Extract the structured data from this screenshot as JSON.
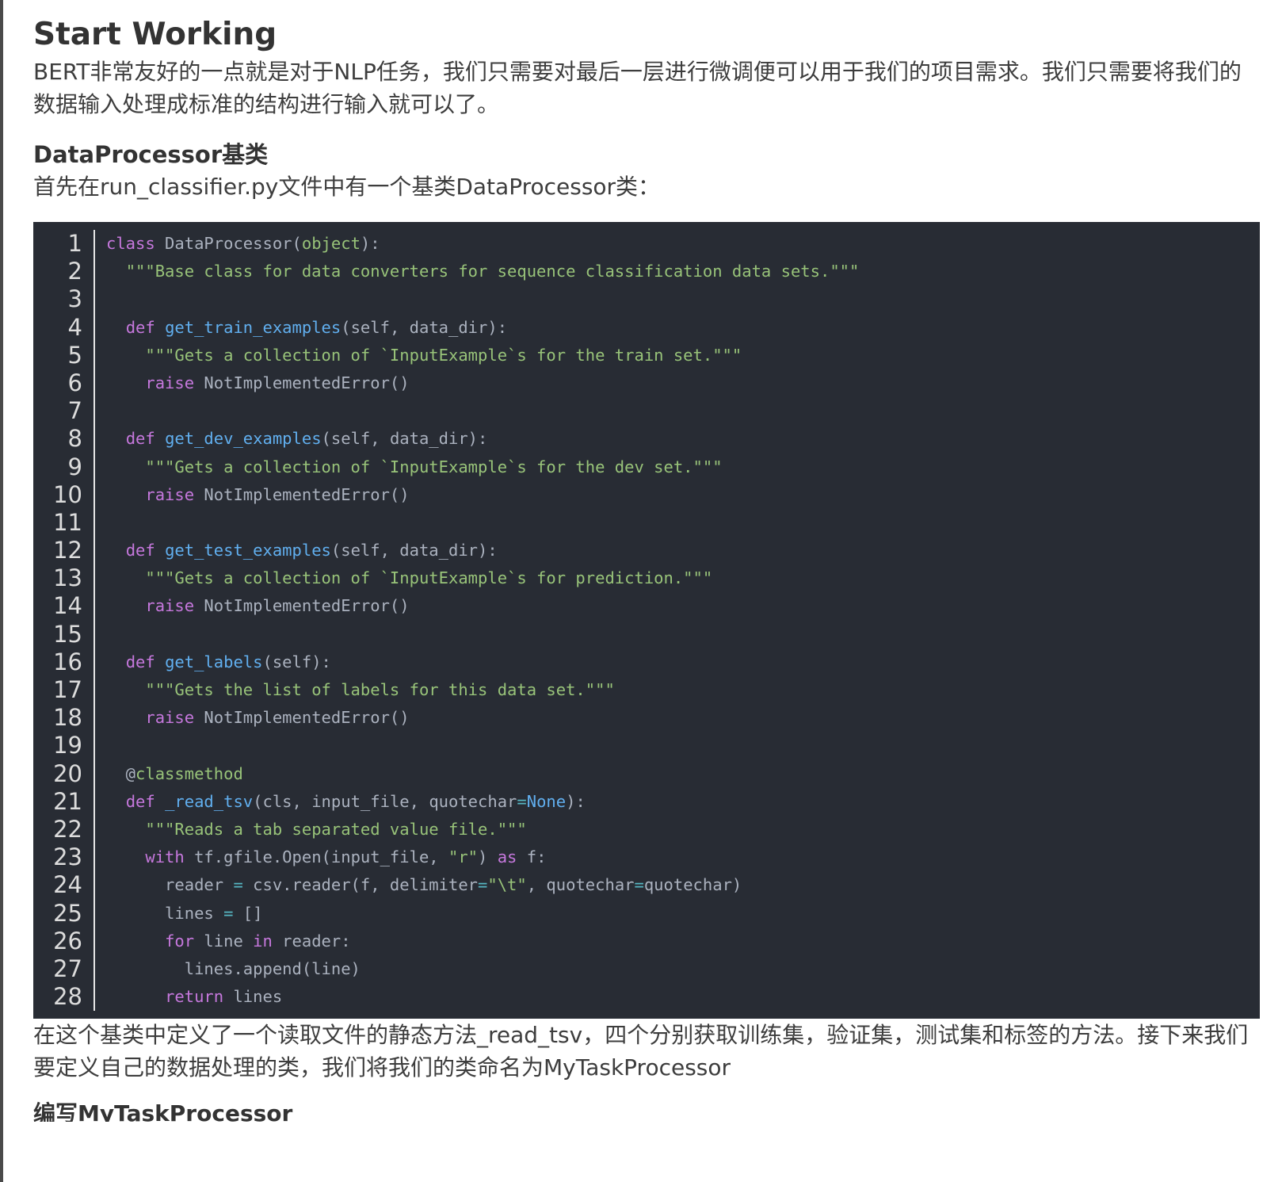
{
  "article": {
    "title": "Start Working",
    "intro": "BERT非常友好的一点就是对于NLP任务，我们只需要对最后一层进行微调便可以用于我们的项目需求。我们只需要将我们的数据输入处理成标准的结构进行输入就可以了。",
    "subtitle": "DataProcessor基类",
    "lead": "首先在run_classifier.py文件中有一个基类DataProcessor类：",
    "after_code": "在这个基类中定义了一个读取文件的静态方法_read_tsv，四个分别获取训练集，验证集，测试集和标签的方法。接下来我们要定义自己的数据处理的类，我们将我们的类命名为MyTaskProcessor",
    "cut_off_heading": "编写MyTaskProcessor"
  },
  "code": {
    "line_numbers": [
      "1",
      "2",
      "3",
      "4",
      "5",
      "6",
      "7",
      "8",
      "9",
      "10",
      "11",
      "12",
      "13",
      "14",
      "15",
      "16",
      "17",
      "18",
      "19",
      "20",
      "21",
      "22",
      "23",
      "24",
      "25",
      "26",
      "27",
      "28"
    ],
    "lines": [
      [
        [
          "kw",
          "class"
        ],
        [
          "pl",
          " DataProcessor("
        ],
        [
          "bi",
          "object"
        ],
        [
          "pl",
          "):"
        ]
      ],
      [
        [
          "pl",
          "  "
        ],
        [
          "st",
          "\"\"\"Base class for data converters for sequence classification data sets.\"\"\""
        ]
      ],
      [],
      [
        [
          "pl",
          "  "
        ],
        [
          "kw",
          "def"
        ],
        [
          "pl",
          " "
        ],
        [
          "fn",
          "get_train_examples"
        ],
        [
          "pl",
          "(self, data_dir):"
        ]
      ],
      [
        [
          "pl",
          "    "
        ],
        [
          "st",
          "\"\"\"Gets a collection of `InputExample`s for the train set.\"\"\""
        ]
      ],
      [
        [
          "pl",
          "    "
        ],
        [
          "kw",
          "raise"
        ],
        [
          "pl",
          " NotImplementedError()"
        ]
      ],
      [],
      [
        [
          "pl",
          "  "
        ],
        [
          "kw",
          "def"
        ],
        [
          "pl",
          " "
        ],
        [
          "fn",
          "get_dev_examples"
        ],
        [
          "pl",
          "(self, data_dir):"
        ]
      ],
      [
        [
          "pl",
          "    "
        ],
        [
          "st",
          "\"\"\"Gets a collection of `InputExample`s for the dev set.\"\"\""
        ]
      ],
      [
        [
          "pl",
          "    "
        ],
        [
          "kw",
          "raise"
        ],
        [
          "pl",
          " NotImplementedError()"
        ]
      ],
      [],
      [
        [
          "pl",
          "  "
        ],
        [
          "kw",
          "def"
        ],
        [
          "pl",
          " "
        ],
        [
          "fn",
          "get_test_examples"
        ],
        [
          "pl",
          "(self, data_dir):"
        ]
      ],
      [
        [
          "pl",
          "    "
        ],
        [
          "st",
          "\"\"\"Gets a collection of `InputExample`s for prediction.\"\"\""
        ]
      ],
      [
        [
          "pl",
          "    "
        ],
        [
          "kw",
          "raise"
        ],
        [
          "pl",
          " NotImplementedError()"
        ]
      ],
      [],
      [
        [
          "pl",
          "  "
        ],
        [
          "kw",
          "def"
        ],
        [
          "pl",
          " "
        ],
        [
          "fn",
          "get_labels"
        ],
        [
          "pl",
          "(self):"
        ]
      ],
      [
        [
          "pl",
          "    "
        ],
        [
          "st",
          "\"\"\"Gets the list of labels for this data set.\"\"\""
        ]
      ],
      [
        [
          "pl",
          "    "
        ],
        [
          "kw",
          "raise"
        ],
        [
          "pl",
          " NotImplementedError()"
        ]
      ],
      [],
      [
        [
          "pl",
          "  @"
        ],
        [
          "bi",
          "classmethod"
        ]
      ],
      [
        [
          "pl",
          "  "
        ],
        [
          "kw",
          "def"
        ],
        [
          "pl",
          " "
        ],
        [
          "fn",
          "_read_tsv"
        ],
        [
          "pl",
          "(cls, input_file, quotechar"
        ],
        [
          "op",
          "="
        ],
        [
          "fn",
          "None"
        ],
        [
          "pl",
          "):"
        ]
      ],
      [
        [
          "pl",
          "    "
        ],
        [
          "st",
          "\"\"\"Reads a tab separated value file.\"\"\""
        ]
      ],
      [
        [
          "pl",
          "    "
        ],
        [
          "kw",
          "with"
        ],
        [
          "pl",
          " tf.gfile.Open(input_file, "
        ],
        [
          "st",
          "\"r\""
        ],
        [
          "pl",
          ") "
        ],
        [
          "kw",
          "as"
        ],
        [
          "pl",
          " f:"
        ]
      ],
      [
        [
          "pl",
          "      reader "
        ],
        [
          "op",
          "="
        ],
        [
          "pl",
          " csv.reader(f, delimiter"
        ],
        [
          "op",
          "="
        ],
        [
          "st",
          "\"\\t\""
        ],
        [
          "pl",
          ", quotechar"
        ],
        [
          "op",
          "="
        ],
        [
          "pl",
          "quotechar)"
        ]
      ],
      [
        [
          "pl",
          "      lines "
        ],
        [
          "op",
          "="
        ],
        [
          "pl",
          " []"
        ]
      ],
      [
        [
          "pl",
          "      "
        ],
        [
          "kw",
          "for"
        ],
        [
          "pl",
          " line "
        ],
        [
          "kw",
          "in"
        ],
        [
          "pl",
          " reader:"
        ]
      ],
      [
        [
          "pl",
          "        lines.append(line)"
        ]
      ],
      [
        [
          "pl",
          "      "
        ],
        [
          "kw",
          "return"
        ],
        [
          "pl",
          " lines"
        ]
      ]
    ]
  },
  "colors": {
    "code_background": "#282c34",
    "keyword": "#c678dd",
    "function": "#61afef",
    "string": "#98c379",
    "operator": "#56b6c2",
    "plain": "#abb2bf"
  }
}
